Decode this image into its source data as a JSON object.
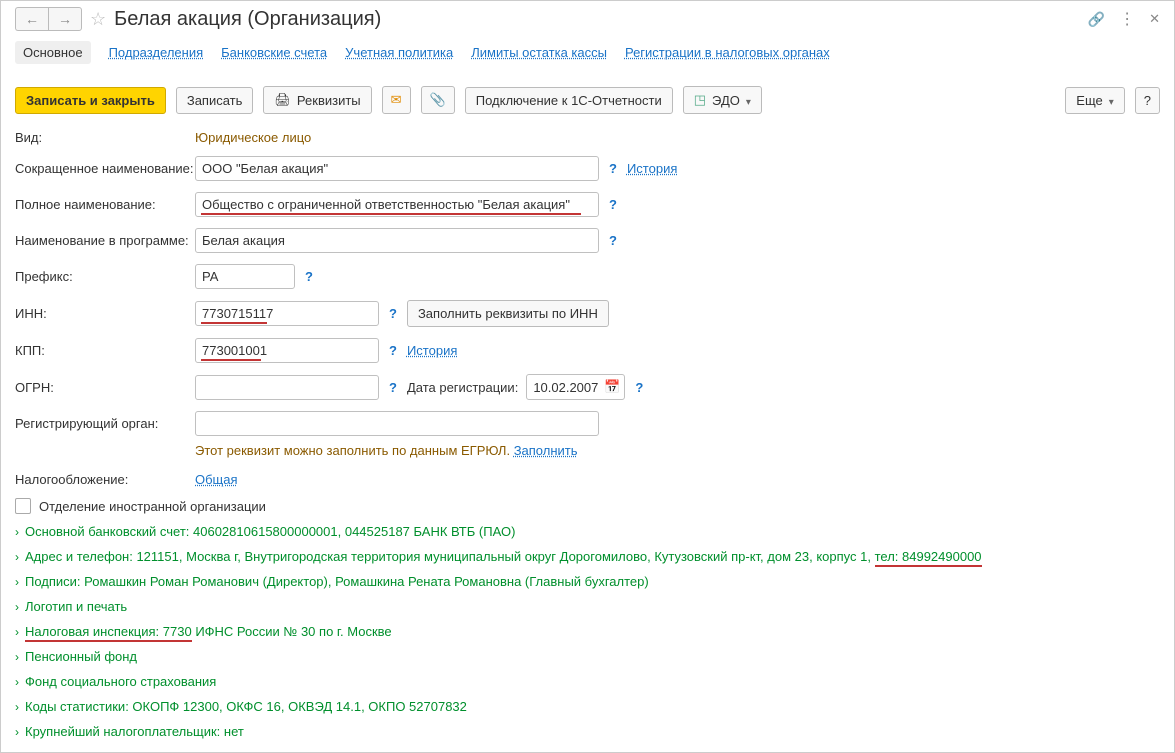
{
  "window": {
    "title": "Белая акация (Организация)"
  },
  "tabs": {
    "main": "Основное",
    "divisions": "Подразделения",
    "bank": "Банковские счета",
    "policy": "Учетная политика",
    "limits": "Лимиты остатка кассы",
    "tax_reg": "Регистрации в налоговых органах"
  },
  "toolbar": {
    "save_close": "Записать и закрыть",
    "save": "Записать",
    "requisites": "Реквизиты",
    "connect_1c": "Подключение к 1С-Отчетности",
    "edo": "ЭДО",
    "more": "Еще",
    "help": "?"
  },
  "form": {
    "kind_label": "Вид:",
    "kind_value": "Юридическое лицо",
    "shortname_label": "Сокращенное наименование:",
    "shortname_value": "ООО \"Белая акация\"",
    "history": "История",
    "fullname_label": "Полное наименование:",
    "fullname_value": "Общество с ограниченной ответственностью \"Белая акация\"",
    "progname_label": "Наименование в программе:",
    "progname_value": "Белая акация",
    "prefix_label": "Префикс:",
    "prefix_value": "РА",
    "inn_label": "ИНН:",
    "inn_value": "7730715117",
    "fill_by_inn": "Заполнить реквизиты по ИНН",
    "kpp_label": "КПП:",
    "kpp_value": "773001001",
    "kpp_history": "История",
    "ogrn_label": "ОГРН:",
    "ogrn_value": "",
    "regdate_label": "Дата регистрации:",
    "regdate_value": "10.02.2007",
    "regorg_label": "Регистрирующий орган:",
    "regorg_value": "",
    "egrul_hint": "Этот реквизит можно заполнить по данным ЕГРЮЛ. ",
    "egrul_fill": "Заполнить",
    "taxation_label": "Налогообложение:",
    "taxation_value": "Общая",
    "foreign_label": "Отделение иностранной организации"
  },
  "expanders": {
    "bank": "Основной банковский счет: 40602810615800000001, 044525187 БАНК ВТБ (ПАО)",
    "address_prefix": "Адрес и телефон: 121151, Москва г, Внутригородская территория муниципальный округ Дорогомилово, Кутузовский пр-кт, дом 23, корпус 1, ",
    "address_phone": "тел: 84992490000",
    "signatures": "Подписи: Ромашкин Роман Романович (Директор), Ромашкина Рената Романовна (Главный бухгалтер)",
    "logo": "Логотип и печать",
    "tax_insp_title": "Налоговая инспекция: 7730",
    "tax_insp_rest": " ИФНС России № 30 по г. Москве",
    "pension": "Пенсионный фонд",
    "social": "Фонд социального страхования",
    "stats": "Коды статистики: ОКОПФ 12300, ОКФС 16, ОКВЭД 14.1, ОКПО 52707832",
    "largest": "Крупнейший налогоплательщик: нет"
  }
}
